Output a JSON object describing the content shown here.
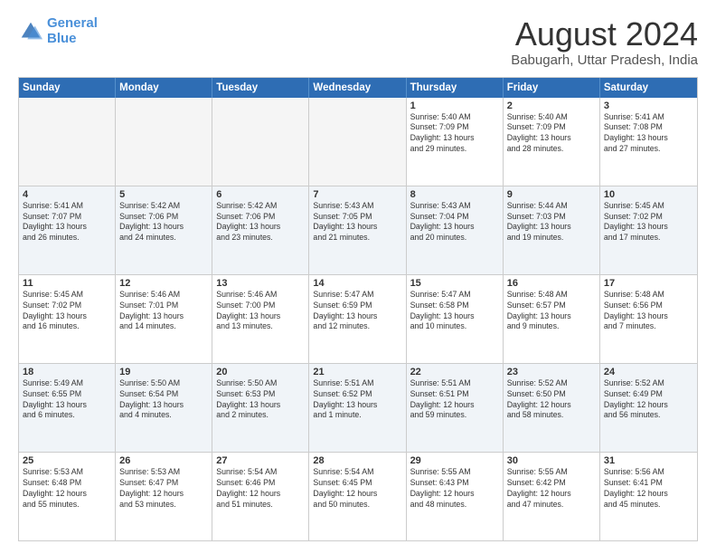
{
  "logo": {
    "line1": "General",
    "line2": "Blue"
  },
  "title": "August 2024",
  "subtitle": "Babugarh, Uttar Pradesh, India",
  "header": {
    "days": [
      "Sunday",
      "Monday",
      "Tuesday",
      "Wednesday",
      "Thursday",
      "Friday",
      "Saturday"
    ]
  },
  "rows": [
    [
      {
        "day": "",
        "empty": true
      },
      {
        "day": "",
        "empty": true
      },
      {
        "day": "",
        "empty": true
      },
      {
        "day": "",
        "empty": true
      },
      {
        "day": "1",
        "lines": [
          "Sunrise: 5:40 AM",
          "Sunset: 7:09 PM",
          "Daylight: 13 hours",
          "and 29 minutes."
        ]
      },
      {
        "day": "2",
        "lines": [
          "Sunrise: 5:40 AM",
          "Sunset: 7:09 PM",
          "Daylight: 13 hours",
          "and 28 minutes."
        ]
      },
      {
        "day": "3",
        "lines": [
          "Sunrise: 5:41 AM",
          "Sunset: 7:08 PM",
          "Daylight: 13 hours",
          "and 27 minutes."
        ]
      }
    ],
    [
      {
        "day": "4",
        "lines": [
          "Sunrise: 5:41 AM",
          "Sunset: 7:07 PM",
          "Daylight: 13 hours",
          "and 26 minutes."
        ]
      },
      {
        "day": "5",
        "lines": [
          "Sunrise: 5:42 AM",
          "Sunset: 7:06 PM",
          "Daylight: 13 hours",
          "and 24 minutes."
        ]
      },
      {
        "day": "6",
        "lines": [
          "Sunrise: 5:42 AM",
          "Sunset: 7:06 PM",
          "Daylight: 13 hours",
          "and 23 minutes."
        ]
      },
      {
        "day": "7",
        "lines": [
          "Sunrise: 5:43 AM",
          "Sunset: 7:05 PM",
          "Daylight: 13 hours",
          "and 21 minutes."
        ]
      },
      {
        "day": "8",
        "lines": [
          "Sunrise: 5:43 AM",
          "Sunset: 7:04 PM",
          "Daylight: 13 hours",
          "and 20 minutes."
        ]
      },
      {
        "day": "9",
        "lines": [
          "Sunrise: 5:44 AM",
          "Sunset: 7:03 PM",
          "Daylight: 13 hours",
          "and 19 minutes."
        ]
      },
      {
        "day": "10",
        "lines": [
          "Sunrise: 5:45 AM",
          "Sunset: 7:02 PM",
          "Daylight: 13 hours",
          "and 17 minutes."
        ]
      }
    ],
    [
      {
        "day": "11",
        "lines": [
          "Sunrise: 5:45 AM",
          "Sunset: 7:02 PM",
          "Daylight: 13 hours",
          "and 16 minutes."
        ]
      },
      {
        "day": "12",
        "lines": [
          "Sunrise: 5:46 AM",
          "Sunset: 7:01 PM",
          "Daylight: 13 hours",
          "and 14 minutes."
        ]
      },
      {
        "day": "13",
        "lines": [
          "Sunrise: 5:46 AM",
          "Sunset: 7:00 PM",
          "Daylight: 13 hours",
          "and 13 minutes."
        ]
      },
      {
        "day": "14",
        "lines": [
          "Sunrise: 5:47 AM",
          "Sunset: 6:59 PM",
          "Daylight: 13 hours",
          "and 12 minutes."
        ]
      },
      {
        "day": "15",
        "lines": [
          "Sunrise: 5:47 AM",
          "Sunset: 6:58 PM",
          "Daylight: 13 hours",
          "and 10 minutes."
        ]
      },
      {
        "day": "16",
        "lines": [
          "Sunrise: 5:48 AM",
          "Sunset: 6:57 PM",
          "Daylight: 13 hours",
          "and 9 minutes."
        ]
      },
      {
        "day": "17",
        "lines": [
          "Sunrise: 5:48 AM",
          "Sunset: 6:56 PM",
          "Daylight: 13 hours",
          "and 7 minutes."
        ]
      }
    ],
    [
      {
        "day": "18",
        "lines": [
          "Sunrise: 5:49 AM",
          "Sunset: 6:55 PM",
          "Daylight: 13 hours",
          "and 6 minutes."
        ]
      },
      {
        "day": "19",
        "lines": [
          "Sunrise: 5:50 AM",
          "Sunset: 6:54 PM",
          "Daylight: 13 hours",
          "and 4 minutes."
        ]
      },
      {
        "day": "20",
        "lines": [
          "Sunrise: 5:50 AM",
          "Sunset: 6:53 PM",
          "Daylight: 13 hours",
          "and 2 minutes."
        ]
      },
      {
        "day": "21",
        "lines": [
          "Sunrise: 5:51 AM",
          "Sunset: 6:52 PM",
          "Daylight: 13 hours",
          "and 1 minute."
        ]
      },
      {
        "day": "22",
        "lines": [
          "Sunrise: 5:51 AM",
          "Sunset: 6:51 PM",
          "Daylight: 12 hours",
          "and 59 minutes."
        ]
      },
      {
        "day": "23",
        "lines": [
          "Sunrise: 5:52 AM",
          "Sunset: 6:50 PM",
          "Daylight: 12 hours",
          "and 58 minutes."
        ]
      },
      {
        "day": "24",
        "lines": [
          "Sunrise: 5:52 AM",
          "Sunset: 6:49 PM",
          "Daylight: 12 hours",
          "and 56 minutes."
        ]
      }
    ],
    [
      {
        "day": "25",
        "lines": [
          "Sunrise: 5:53 AM",
          "Sunset: 6:48 PM",
          "Daylight: 12 hours",
          "and 55 minutes."
        ]
      },
      {
        "day": "26",
        "lines": [
          "Sunrise: 5:53 AM",
          "Sunset: 6:47 PM",
          "Daylight: 12 hours",
          "and 53 minutes."
        ]
      },
      {
        "day": "27",
        "lines": [
          "Sunrise: 5:54 AM",
          "Sunset: 6:46 PM",
          "Daylight: 12 hours",
          "and 51 minutes."
        ]
      },
      {
        "day": "28",
        "lines": [
          "Sunrise: 5:54 AM",
          "Sunset: 6:45 PM",
          "Daylight: 12 hours",
          "and 50 minutes."
        ]
      },
      {
        "day": "29",
        "lines": [
          "Sunrise: 5:55 AM",
          "Sunset: 6:43 PM",
          "Daylight: 12 hours",
          "and 48 minutes."
        ]
      },
      {
        "day": "30",
        "lines": [
          "Sunrise: 5:55 AM",
          "Sunset: 6:42 PM",
          "Daylight: 12 hours",
          "and 47 minutes."
        ]
      },
      {
        "day": "31",
        "lines": [
          "Sunrise: 5:56 AM",
          "Sunset: 6:41 PM",
          "Daylight: 12 hours",
          "and 45 minutes."
        ]
      }
    ]
  ]
}
